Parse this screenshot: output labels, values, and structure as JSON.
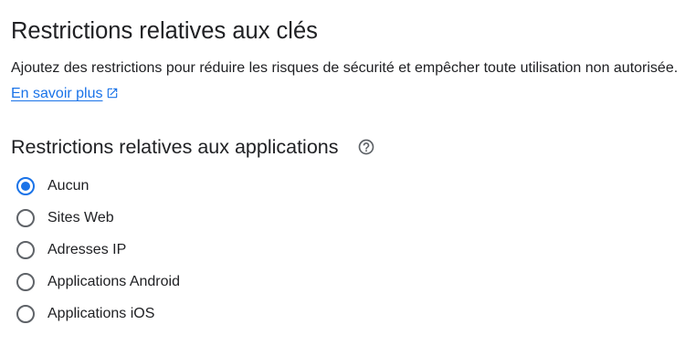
{
  "header": {
    "title": "Restrictions relatives aux clés",
    "description": "Ajoutez des restrictions pour réduire les risques de sécurité et empêcher toute utilisation non autorisée.",
    "learn_more": "En savoir plus",
    "learn_more_icon": "open-in-new-icon"
  },
  "app_restrictions": {
    "title": "Restrictions relatives aux applications",
    "help_icon": "help-circle-icon",
    "accent_color": "#1a73e8",
    "selected": "Aucun",
    "options": [
      {
        "label": "Aucun",
        "checked": true
      },
      {
        "label": "Sites Web",
        "checked": false
      },
      {
        "label": "Adresses IP",
        "checked": false
      },
      {
        "label": "Applications Android",
        "checked": false
      },
      {
        "label": "Applications iOS",
        "checked": false
      }
    ]
  }
}
